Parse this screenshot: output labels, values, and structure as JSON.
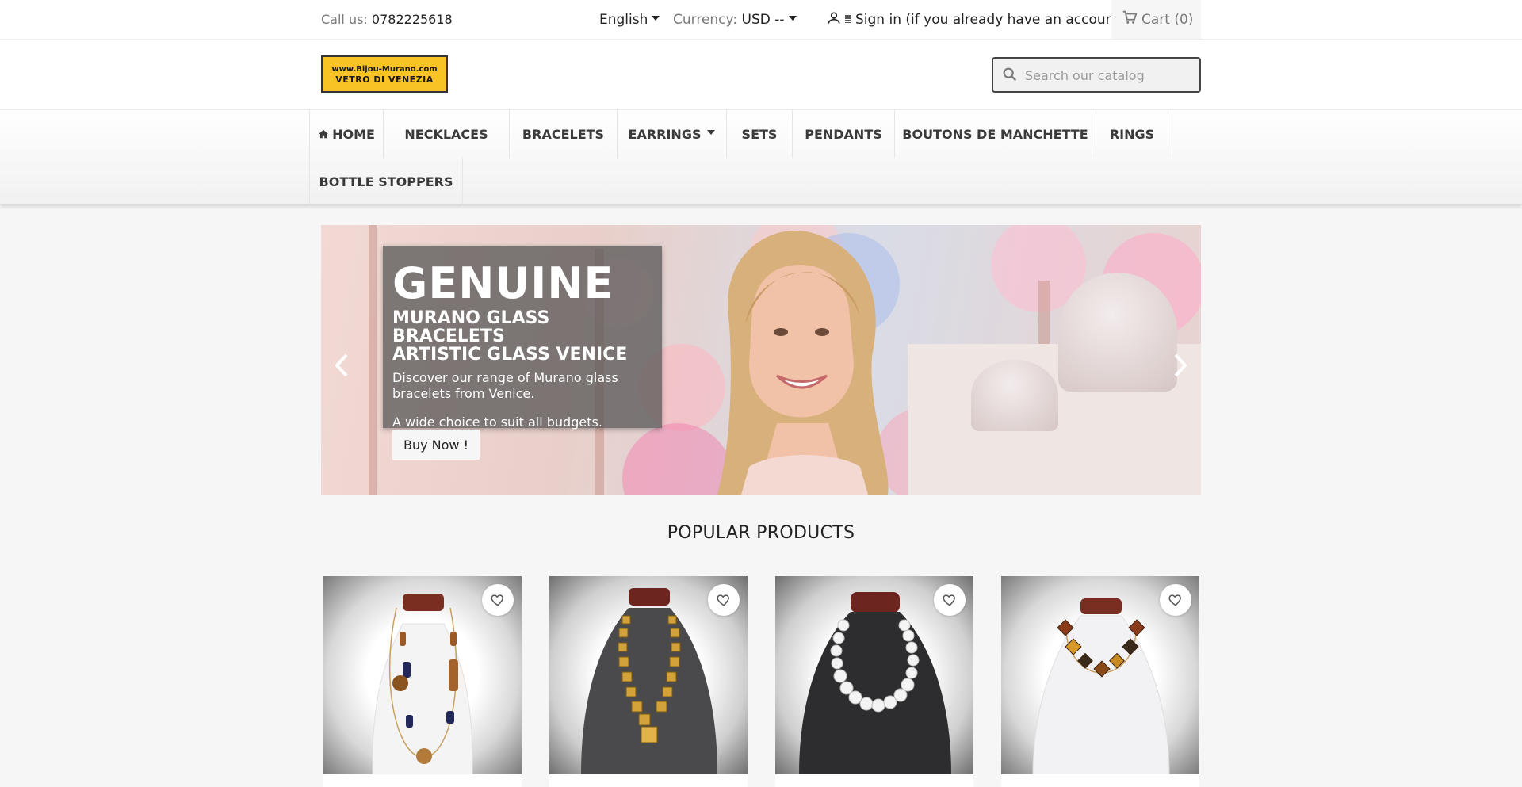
{
  "topbar": {
    "contact_label": "Call us:",
    "contact_phone": "0782225618",
    "language": "English",
    "currency_label": "Currency:",
    "currency_value": "USD --",
    "signin_text": "Sign in (if you already have an account)",
    "cart_text": "Cart (0)"
  },
  "header": {
    "logo_line1": "www.Bijou-Murano.com",
    "logo_line2": "VETRO DI VENEZIA",
    "search_placeholder": "Search our catalog"
  },
  "menu": {
    "items": [
      {
        "label": "HOME",
        "icon": "home-icon"
      },
      {
        "label": "NECKLACES"
      },
      {
        "label": "BRACELETS"
      },
      {
        "label": "EARRINGS",
        "has_dropdown": true
      },
      {
        "label": "SETS"
      },
      {
        "label": "PENDANTS"
      },
      {
        "label": "BOUTONS DE MANCHETTE"
      },
      {
        "label": "RINGS"
      },
      {
        "label": "BOTTLE STOPPERS"
      }
    ]
  },
  "slider": {
    "title": "GENUINE",
    "subtitle_line1": "MURANO GLASS BRACELETS",
    "subtitle_line2": "ARTISTIC GLASS VENICE",
    "description": "Discover our range of Murano glass bracelets from Venice.",
    "description2": "A wide choice to suit all budgets.",
    "cta_label": "Buy Now !"
  },
  "products": {
    "heading": "POPULAR PRODUCTS",
    "items": [
      {
        "name": "necklace-amber-blue"
      },
      {
        "name": "necklace-gold-squares"
      },
      {
        "name": "necklace-white-pearls"
      },
      {
        "name": "necklace-brown-cubes"
      }
    ]
  },
  "colors": {
    "accent": "#f7c325",
    "text": "#232323",
    "muted": "#7a7a7a",
    "background": "#f6f6f6"
  }
}
